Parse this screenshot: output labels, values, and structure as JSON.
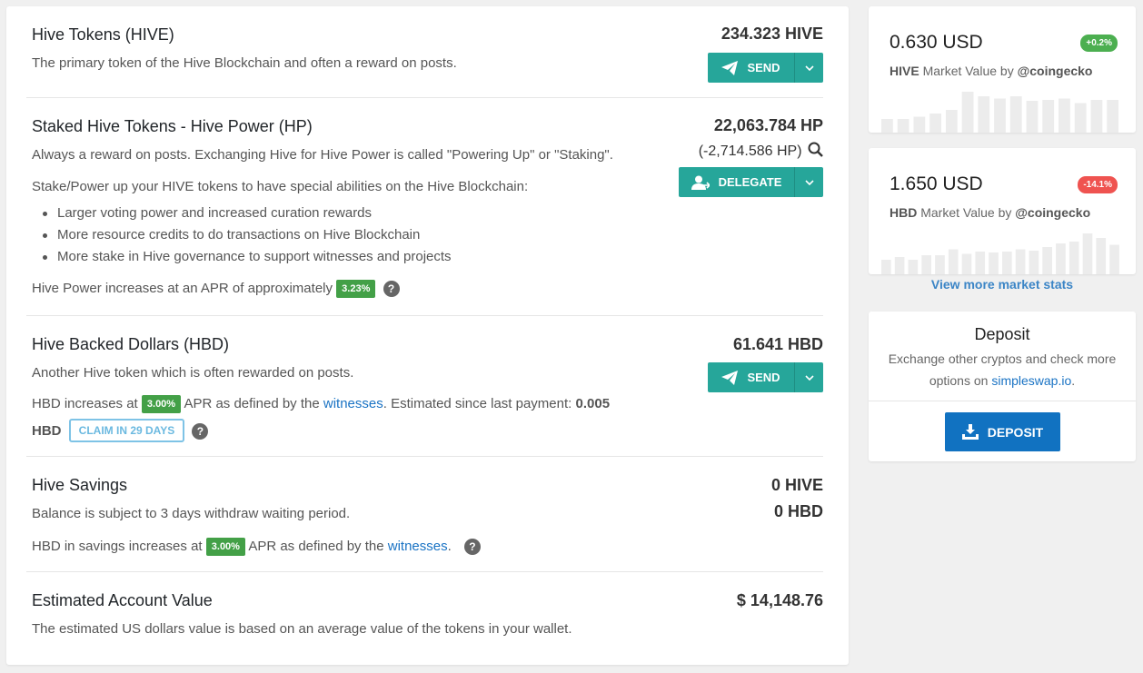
{
  "hive": {
    "title": "Hive Tokens (HIVE)",
    "desc": "The primary token of the Hive Blockchain and often a reward on posts.",
    "amount": "234.323 HIVE",
    "send_label": "SEND"
  },
  "hp": {
    "title": "Staked Hive Tokens - Hive Power (HP)",
    "desc": "Always a reward on posts. Exchanging Hive for Hive Power is called \"Powering Up\" or \"Staking\".",
    "desc2": "Stake/Power up your HIVE tokens to have special abilities on the Hive Blockchain:",
    "bullets": [
      "Larger voting power and increased curation rewards",
      "More resource credits to do transactions on Hive Blockchain",
      "More stake in Hive governance to support witnesses and projects"
    ],
    "apr_text": "Hive Power increases at an APR of approximately",
    "apr": "3.23%",
    "amount": "22,063.784 HP",
    "delegated": "(-2,714.586 HP)",
    "delegate_label": "DELEGATE"
  },
  "hbd": {
    "title": "Hive Backed Dollars (HBD)",
    "desc": "Another Hive token which is often rewarded on posts.",
    "apr_prefix": "HBD increases at",
    "apr": "3.00%",
    "apr_mid": "APR as defined by the",
    "witnesses_link": "witnesses",
    "estimated_text": ". Estimated since last payment:",
    "estimated_value": "0.005",
    "estimated_unit": "HBD",
    "claim_label": "CLAIM IN 29 DAYS",
    "amount": "61.641 HBD",
    "send_label": "SEND"
  },
  "savings": {
    "title": "Hive Savings",
    "desc": "Balance is subject to 3 days withdraw waiting period.",
    "apr_prefix": "HBD in savings increases at",
    "apr": "3.00%",
    "apr_mid": "APR as defined by the",
    "witnesses_link": "witnesses",
    "apr_suffix": ".",
    "amount_hive": "0 HIVE",
    "amount_hbd": "0 HBD"
  },
  "estimated": {
    "title": "Estimated Account Value",
    "desc": "The estimated US dollars value is based on an average value of the tokens in your wallet.",
    "amount": "$ 14,148.76"
  },
  "market_hive": {
    "price": "0.630 USD",
    "change": "+0.2%",
    "change_color": "#4caf50",
    "token": "HIVE",
    "source_text": "Market Value by",
    "source": "@coingecko",
    "sparkline": [
      0.3,
      0.3,
      0.35,
      0.42,
      0.5,
      0.9,
      0.8,
      0.75,
      0.8,
      0.7,
      0.72,
      0.75,
      0.65,
      0.72,
      0.72
    ]
  },
  "market_hbd": {
    "price": "1.650 USD",
    "change": "-14.1%",
    "change_color": "#ef5350",
    "token": "HBD",
    "source_text": "Market Value by",
    "source": "@coingecko",
    "sparkline": [
      0.32,
      0.38,
      0.32,
      0.42,
      0.42,
      0.55,
      0.45,
      0.5,
      0.48,
      0.5,
      0.55,
      0.52,
      0.6,
      0.68,
      0.72,
      0.9,
      0.8,
      0.65
    ]
  },
  "view_more": "View more market stats",
  "deposit": {
    "title": "Deposit",
    "text_line1": "Exchange other cryptos and check more",
    "text_line2_prefix": "options on",
    "link": "simpleswap.io",
    "text_line2_suffix": ".",
    "button_label": "DEPOSIT"
  }
}
